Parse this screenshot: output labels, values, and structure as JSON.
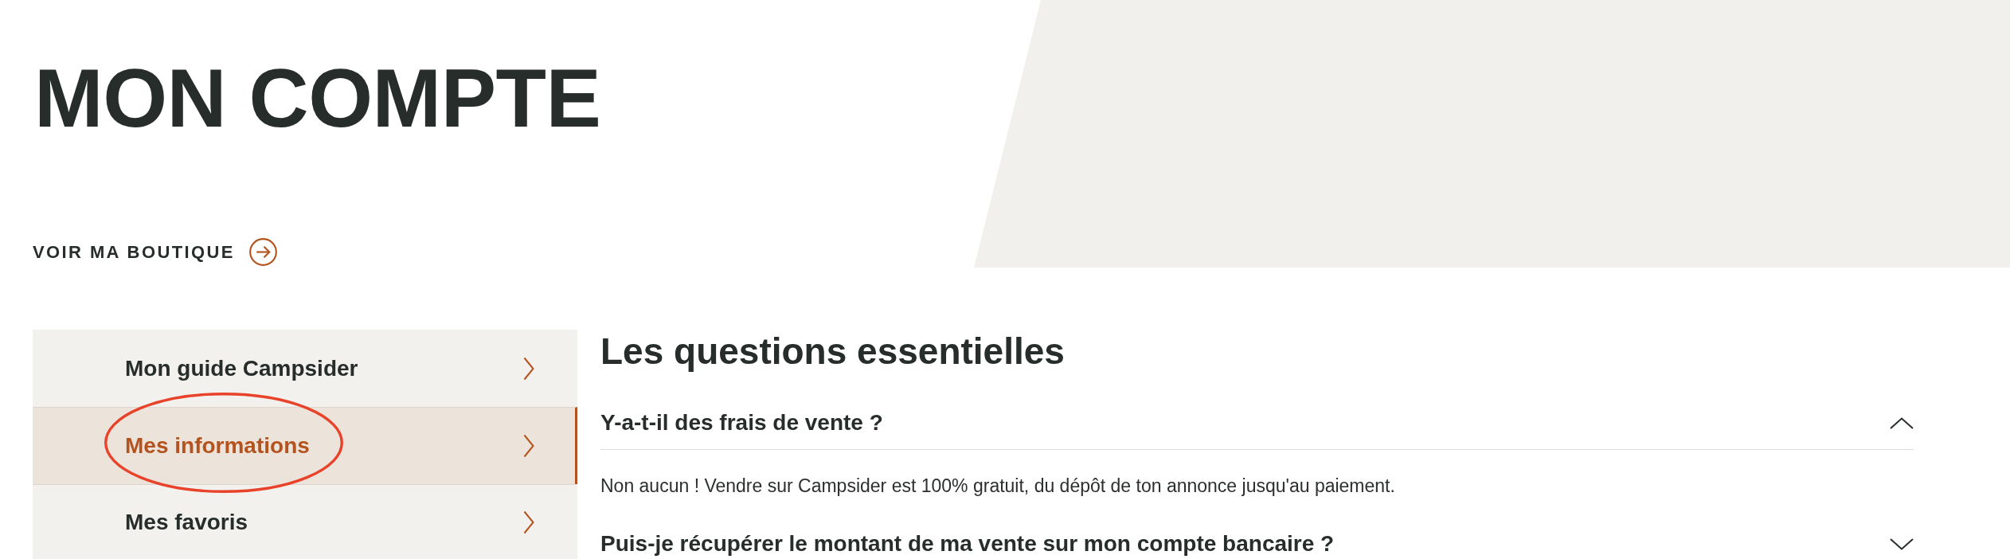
{
  "header": {
    "title": "MON COMPTE",
    "shop_link": "VOIR MA BOUTIQUE"
  },
  "sidebar": {
    "items": [
      {
        "label": "Mon guide Campsider",
        "selected": false,
        "circled": false
      },
      {
        "label": "Mes informations",
        "selected": true,
        "circled": true
      },
      {
        "label": "Mes favoris",
        "selected": false,
        "circled": false
      }
    ]
  },
  "faq": {
    "title": "Les questions essentielles",
    "items": [
      {
        "question": "Y-a-t-il des frais de vente ?",
        "expanded": true,
        "answer": "Non aucun ! Vendre sur Campsider est 100% gratuit, du dépôt de ton annonce jusqu'au paiement."
      },
      {
        "question": "Puis-je récupérer le montant de ma vente sur mon compte bancaire ?",
        "expanded": false
      }
    ]
  }
}
